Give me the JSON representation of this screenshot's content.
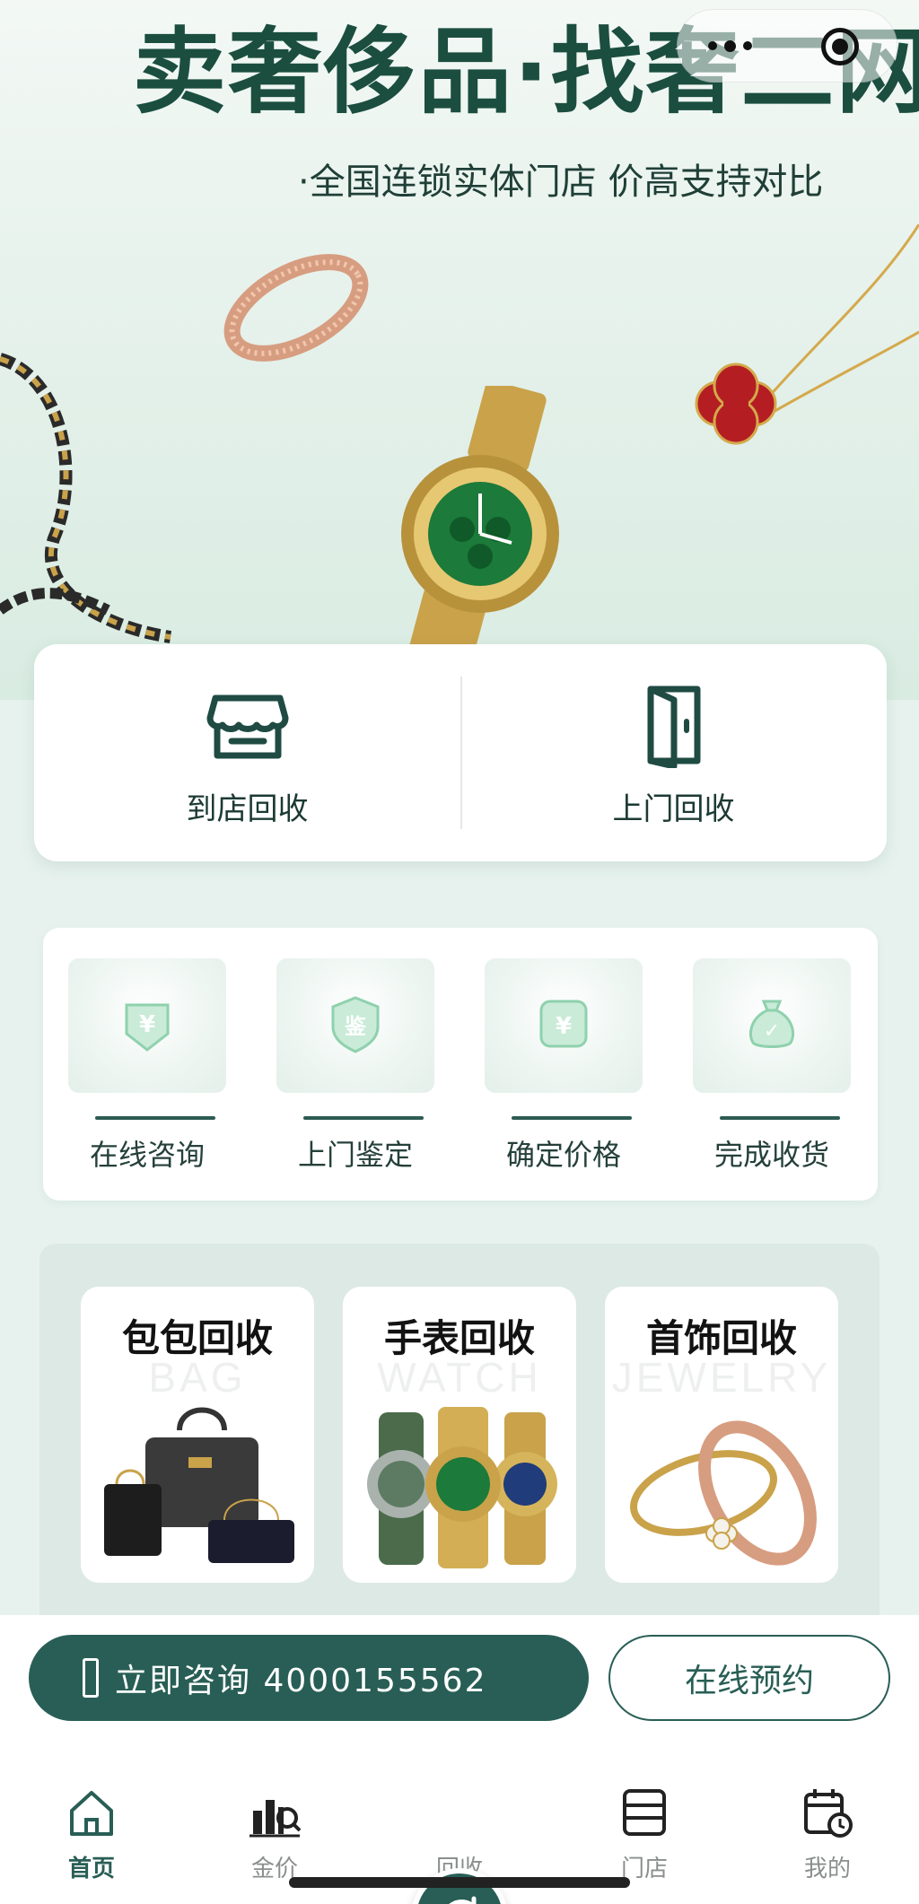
{
  "hero": {
    "title": "卖奢侈品·找奢二网",
    "subtitle": "·全国连锁实体门店 价高支持对比"
  },
  "services": [
    {
      "label": "到店回收",
      "icon": "store-icon"
    },
    {
      "label": "上门回收",
      "icon": "door-icon"
    }
  ],
  "steps": [
    {
      "label": "在线咨询",
      "symbol": "¥"
    },
    {
      "label": "上门鉴定",
      "symbol": "鉴"
    },
    {
      "label": "确定价格",
      "symbol": "¥"
    },
    {
      "label": "完成收货",
      "symbol": "✓"
    }
  ],
  "categories": [
    {
      "name": "包包回收",
      "en": "BAG"
    },
    {
      "name": "手表回收",
      "en": "WATCH"
    },
    {
      "name": "首饰回收",
      "en": "JEWELRY"
    }
  ],
  "actions": {
    "consult": "立即咨询 4000155562",
    "book": "在线预约"
  },
  "tabs": [
    {
      "label": "首页"
    },
    {
      "label": "金价"
    },
    {
      "label": "回收"
    },
    {
      "label": "门店"
    },
    {
      "label": "我的"
    }
  ],
  "colors": {
    "brand": "#285e55",
    "accent_gold": "#c9a24a",
    "accent_red": "#b41e22"
  }
}
